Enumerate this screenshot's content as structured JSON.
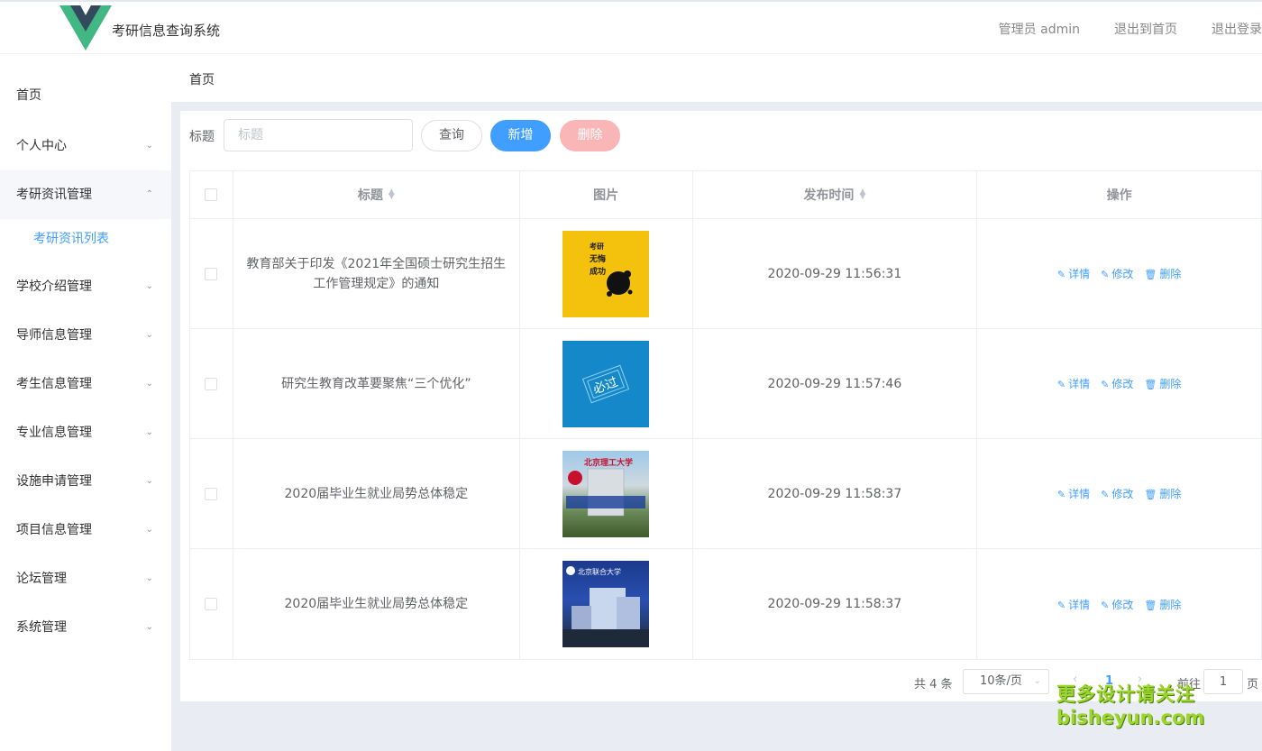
{
  "header": {
    "app_title": "考研信息查询系统",
    "user": "管理员 admin",
    "back_home": "退出到首页",
    "logout": "退出登录"
  },
  "sidebar": {
    "items": [
      {
        "label": "首页"
      },
      {
        "label": "个人中心"
      },
      {
        "label": "考研资讯管理"
      },
      {
        "label": "学校介绍管理"
      },
      {
        "label": "导师信息管理"
      },
      {
        "label": "考生信息管理"
      },
      {
        "label": "专业信息管理"
      },
      {
        "label": "设施申请管理"
      },
      {
        "label": "项目信息管理"
      },
      {
        "label": "论坛管理"
      },
      {
        "label": "系统管理"
      }
    ],
    "sub_item": "考研资讯列表"
  },
  "breadcrumb": "首页",
  "search": {
    "label": "标题",
    "placeholder": "标题",
    "query_label": "查询",
    "add_label": "新增",
    "delete_label": "删除"
  },
  "table": {
    "headers": {
      "title": "标题",
      "image": "图片",
      "time": "发布时间",
      "actions": "操作"
    },
    "rows": [
      {
        "title": "教育部关于印发《2021年全国硕士研究生招生工作管理规定》的通知",
        "time": "2020-09-29 11:56:31",
        "image_text": "考研 无悔 成功"
      },
      {
        "title": "研究生教育改革要聚焦“三个优化”",
        "time": "2020-09-29 11:57:46",
        "image_text": "必过"
      },
      {
        "title": "2020届毕业生就业局势总体稳定",
        "time": "2020-09-29 11:58:37",
        "image_text": "北京理工大学"
      },
      {
        "title": "2020届毕业生就业局势总体稳定",
        "time": "2020-09-29 11:58:37",
        "image_text": "北京联合大学"
      }
    ],
    "ops": {
      "detail": "详情",
      "edit": "修改",
      "delete": "删除"
    }
  },
  "pager": {
    "total": "共 4 条",
    "size": "10条/页",
    "current": "1",
    "goto": "前往",
    "goto_value": "1",
    "page_suffix": "页"
  },
  "watermark": {
    "line1": "更多设计请关注",
    "line2": "bisheyun.com"
  },
  "colors": {
    "primary": "#409eff",
    "danger_light": "#fab6b6",
    "logo_dark": "#35495e",
    "logo_green": "#41b883"
  }
}
